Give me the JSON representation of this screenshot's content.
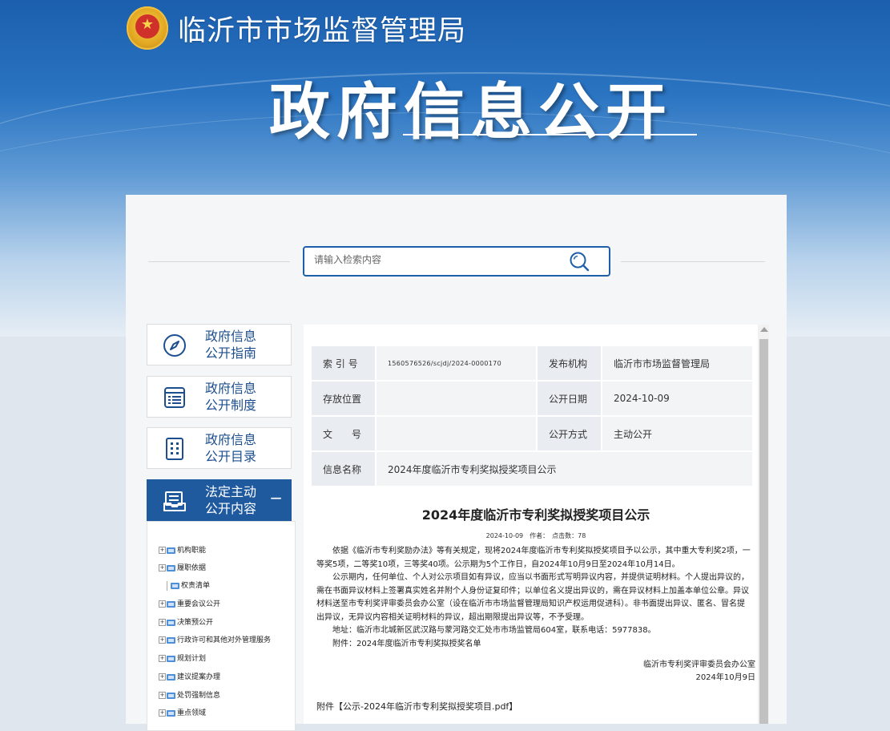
{
  "header": {
    "site_name": "临沂市市场监督管理局",
    "page_title": "政府信息公开"
  },
  "search": {
    "placeholder": "请输入检索内容"
  },
  "nav": [
    {
      "line1": "政府信息",
      "line2": "公开指南",
      "icon": "compass-icon"
    },
    {
      "line1": "政府信息",
      "line2": "公开制度",
      "icon": "list-icon"
    },
    {
      "line1": "政府信息",
      "line2": "公开目录",
      "icon": "catalog-icon"
    },
    {
      "line1": "法定主动",
      "line2": "公开内容",
      "icon": "inbox-icon",
      "collapse": "−"
    }
  ],
  "tree": [
    {
      "label": "机构职能",
      "toggle": "+"
    },
    {
      "label": "履职依据",
      "toggle": "+"
    },
    {
      "label": "权责清单",
      "toggle": ""
    },
    {
      "label": "重要会议公开",
      "toggle": "+"
    },
    {
      "label": "决策预公开",
      "toggle": "+"
    },
    {
      "label": "行政许可和其他对外管理服务",
      "toggle": "+"
    },
    {
      "label": "规划计划",
      "toggle": "+"
    },
    {
      "label": "建议提案办理",
      "toggle": "+"
    },
    {
      "label": "处罚强制信息",
      "toggle": "+"
    },
    {
      "label": "重点领域",
      "toggle": "+"
    }
  ],
  "meta": {
    "index_label": "索 引 号",
    "index_value": "1560576526/scjdj/2024-0000170",
    "publisher_label": "发布机构",
    "publisher_value": "临沂市市场监督管理局",
    "location_label": "存放位置",
    "location_value": "",
    "date_label": "公开日期",
    "date_value": "2024-10-09",
    "docno_label": "文　　号",
    "docno_value": "",
    "method_label": "公开方式",
    "method_value": "主动公开",
    "name_label": "信息名称",
    "name_value": "2024年度临沂市专利奖拟授奖项目公示"
  },
  "article": {
    "title": "2024年度临沂市专利奖拟授奖项目公示",
    "meta_line": "2024-10-09　作者：　点击数：78",
    "paragraphs": [
      "依据《临沂市专利奖励办法》等有关规定，现将2024年度临沂市专利奖拟授奖项目予以公示，其中重大专利奖2项，一等奖5项，二等奖10项，三等奖40项。公示期为5个工作日，自2024年10月9日至2024年10月14日。",
      "公示期内，任何单位、个人对公示项目如有异议，应当以书面形式写明异议内容，并提供证明材料。个人提出异议的，需在书面异议材料上签署真实姓名并附个人身份证复印件；以单位名义提出异议的，需在异议材料上加盖本单位公章。异议材料送至市专利奖评审委员会办公室（设在临沂市市场监督管理局知识产权运用促进科）。非书面提出异议、匿名、冒名提出异议，无异议内容相关证明材料的异议，超出期限提出异议等，不予受理。",
      "地址：临沂市北城新区武汉路与蒙河路交汇处市市场监管局604室，联系电话：5977838。",
      "附件：2024年度临沂市专利奖拟授奖名单"
    ],
    "sign_org": "临沂市专利奖评审委员会办公室",
    "sign_date": "2024年10月9日",
    "attachment": "附件【公示-2024年临沂市专利奖拟授奖项目.pdf】"
  },
  "colors": {
    "brand_blue": "#1f5a9e",
    "nav_text": "#1d4f8f"
  }
}
